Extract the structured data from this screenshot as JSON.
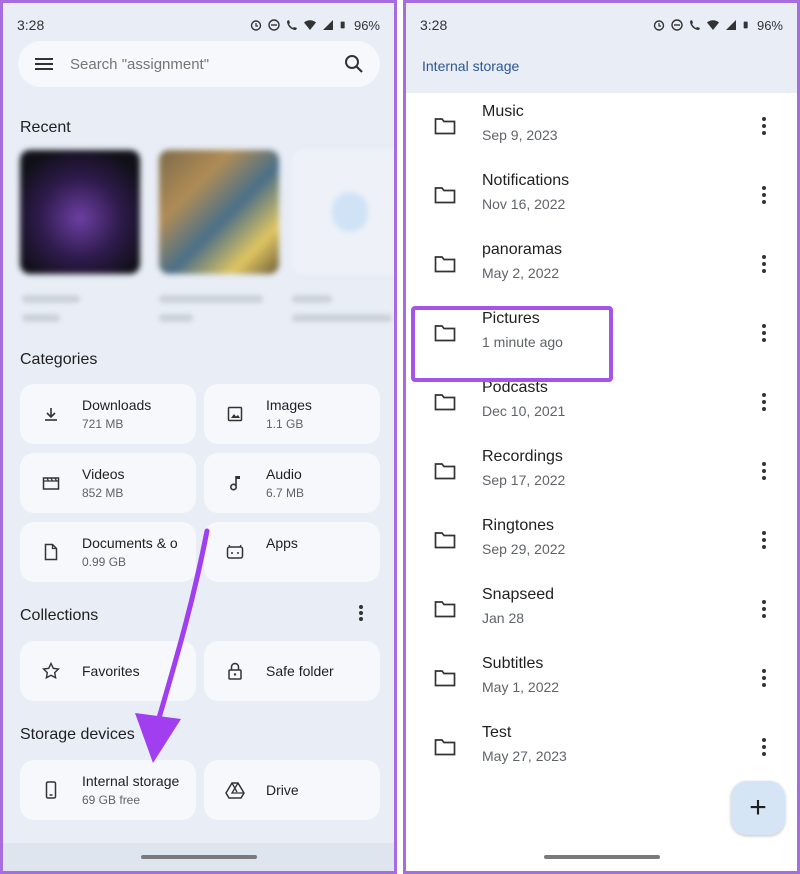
{
  "left": {
    "status": {
      "time": "3:28",
      "battery": "96%"
    },
    "search": {
      "placeholder": "Search \"assignment\""
    },
    "recent_title": "Recent",
    "categories_title": "Categories",
    "categories": [
      {
        "label": "Downloads",
        "sub": "721 MB",
        "icon": "download-icon"
      },
      {
        "label": "Images",
        "sub": "1.1 GB",
        "icon": "image-icon"
      },
      {
        "label": "Videos",
        "sub": "852 MB",
        "icon": "video-icon"
      },
      {
        "label": "Audio",
        "sub": "6.7 MB",
        "icon": "music-note-icon"
      },
      {
        "label": "Documents & o",
        "sub": "0.99 GB",
        "icon": "document-icon"
      },
      {
        "label": "Apps",
        "sub": "",
        "icon": "apps-icon"
      }
    ],
    "collections_title": "Collections",
    "collections": [
      {
        "label": "Favorites",
        "icon": "star-icon"
      },
      {
        "label": "Safe folder",
        "icon": "lock-icon"
      }
    ],
    "storage_title": "Storage devices",
    "storage": [
      {
        "label": "Internal storage",
        "sub": "69 GB free",
        "icon": "phone-icon"
      },
      {
        "label": "Drive",
        "icon": "drive-icon"
      }
    ],
    "arrow_color": "#a13ff0"
  },
  "right": {
    "status": {
      "time": "3:28",
      "battery": "96%"
    },
    "title": "Internal storage",
    "folders": [
      {
        "name": "Music",
        "date": "Sep 9, 2023"
      },
      {
        "name": "Notifications",
        "date": "Nov 16, 2022"
      },
      {
        "name": "panoramas",
        "date": "May 2, 2022"
      },
      {
        "name": "Pictures",
        "date": "1 minute ago"
      },
      {
        "name": "Podcasts",
        "date": "Dec 10, 2021"
      },
      {
        "name": "Recordings",
        "date": "Sep 17, 2022"
      },
      {
        "name": "Ringtones",
        "date": "Sep 29, 2022"
      },
      {
        "name": "Snapseed",
        "date": "Jan 28"
      },
      {
        "name": "Subtitles",
        "date": "May 1, 2022"
      },
      {
        "name": "Test",
        "date": "May 27, 2023"
      }
    ],
    "highlight_color": "#a454e6",
    "fab_label": "+"
  }
}
